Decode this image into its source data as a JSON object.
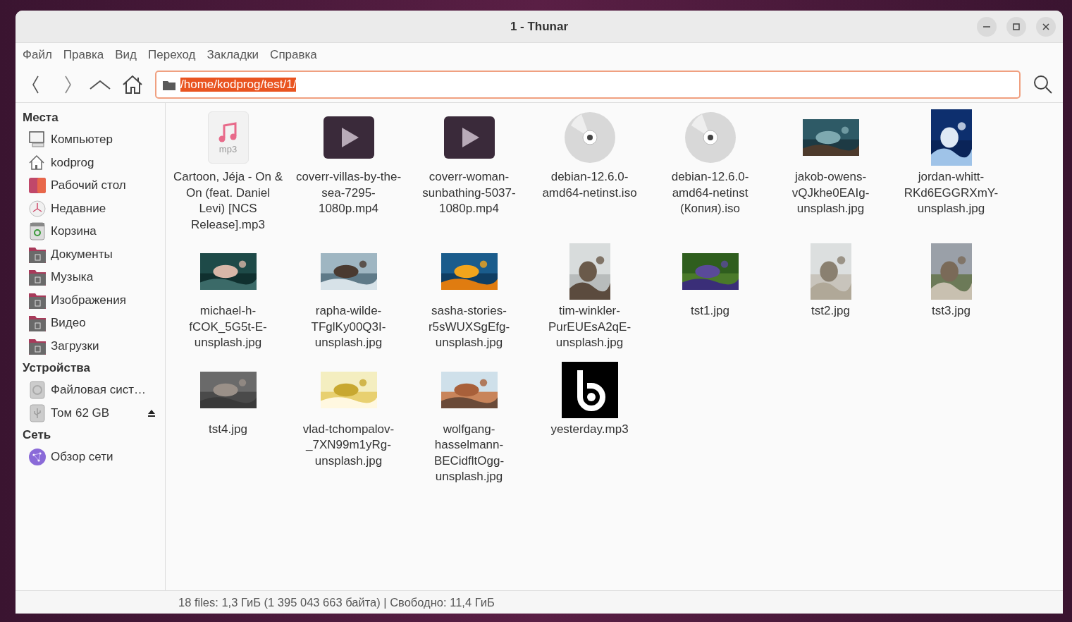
{
  "window": {
    "title": "1 - Thunar"
  },
  "menu": [
    "Файл",
    "Правка",
    "Вид",
    "Переход",
    "Закладки",
    "Справка"
  ],
  "location": {
    "value": "/home/kodprog/test/1/",
    "text_selected": true
  },
  "sidebar": [
    {
      "heading": "Места",
      "items": [
        {
          "label": "Компьютер",
          "kind": "computer"
        },
        {
          "label": "kodprog",
          "kind": "home"
        },
        {
          "label": "Рабочий стол",
          "kind": "desktop"
        },
        {
          "label": "Недавние",
          "kind": "recent"
        },
        {
          "label": "Корзина",
          "kind": "trash"
        },
        {
          "label": "Документы",
          "kind": "folder"
        },
        {
          "label": "Музыка",
          "kind": "folder"
        },
        {
          "label": "Изображения",
          "kind": "folder"
        },
        {
          "label": "Видео",
          "kind": "folder"
        },
        {
          "label": "Загрузки",
          "kind": "folder"
        }
      ]
    },
    {
      "heading": "Устройства",
      "items": [
        {
          "label": "Файловая сист…",
          "kind": "drive"
        },
        {
          "label": "Том 62 GB",
          "kind": "usb",
          "eject": true
        }
      ]
    },
    {
      "heading": "Сеть",
      "items": [
        {
          "label": "Обзор сети",
          "kind": "network"
        }
      ]
    }
  ],
  "files": [
    {
      "name": "Cartoon, Jéja - On & On (feat. Daniel Levi) [NCS Release].mp3",
      "kind": "audio",
      "badge": "mp3"
    },
    {
      "name": "coverr-villas-by-the-sea-7295-1080p.mp4",
      "kind": "video"
    },
    {
      "name": "coverr-woman-sunbathing-5037-1080p.mp4",
      "kind": "video"
    },
    {
      "name": "debian-12.6.0-amd64-netinst.iso",
      "kind": "disc"
    },
    {
      "name": "debian-12.6.0-amd64-netinst (Копия).iso",
      "kind": "disc"
    },
    {
      "name": "jakob-owens-vQJkhe0EAIg-unsplash.jpg",
      "kind": "picture"
    },
    {
      "name": "jordan-whitt-RKd6EGGRXmY-unsplash.jpg",
      "kind": "picture",
      "tall": true
    },
    {
      "name": "michael-h-fCOK_5G5t-E-unsplash.jpg",
      "kind": "picture"
    },
    {
      "name": "rapha-wilde-TFglKy00Q3I-unsplash.jpg",
      "kind": "picture"
    },
    {
      "name": "sasha-stories-r5sWUXSgEfg-unsplash.jpg",
      "kind": "picture"
    },
    {
      "name": "tim-winkler-PurEUEsA2qE-unsplash.jpg",
      "kind": "picture",
      "tall": true
    },
    {
      "name": "tst1.jpg",
      "kind": "picture"
    },
    {
      "name": "tst2.jpg",
      "kind": "picture",
      "tall": true
    },
    {
      "name": "tst3.jpg",
      "kind": "picture",
      "tall": true
    },
    {
      "name": "tst4.jpg",
      "kind": "picture"
    },
    {
      "name": "vlad-tchompalov-_7XN99m1yRg-unsplash.jpg",
      "kind": "picture"
    },
    {
      "name": "wolfgang-hasselmann-BECidfltOgg-unsplash.jpg",
      "kind": "picture"
    },
    {
      "name": "yesterday.mp3",
      "kind": "cover"
    }
  ],
  "status_bar": "18 files: 1,3 ГиБ (1 395 043 663 байта) | Свободно: 11,4 ГиБ"
}
